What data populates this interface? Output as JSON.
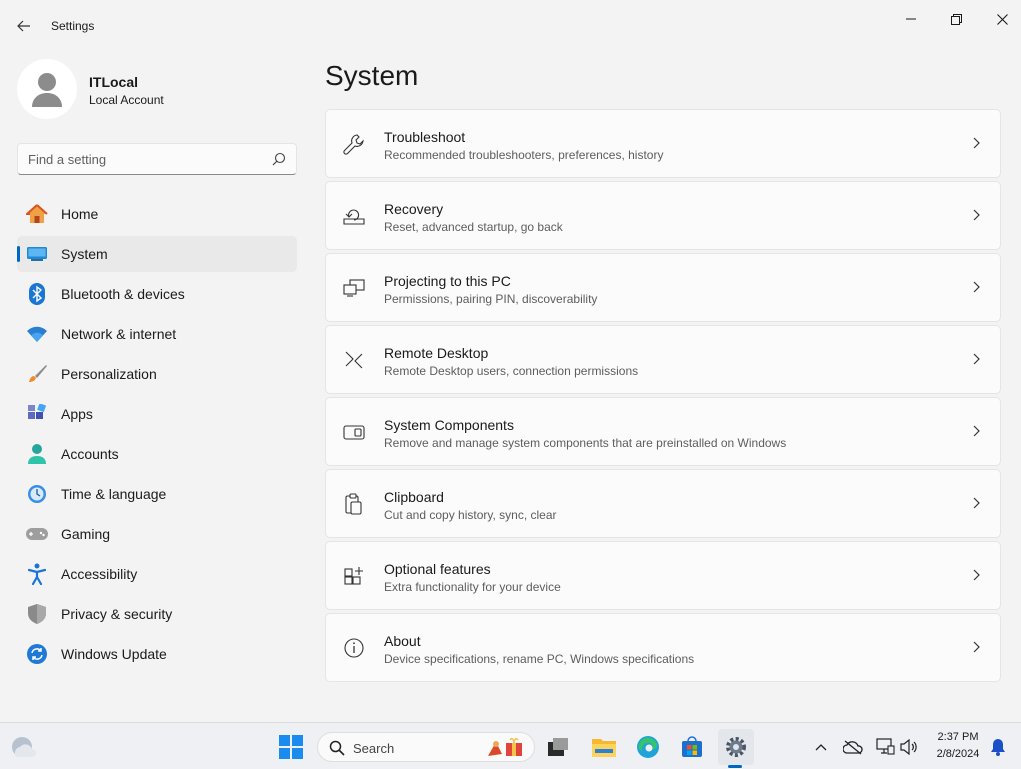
{
  "window": {
    "title": "Settings"
  },
  "profile": {
    "name": "ITLocal",
    "account_type": "Local Account"
  },
  "search": {
    "placeholder": "Find a setting"
  },
  "nav": [
    {
      "label": "Home",
      "icon": "home-icon",
      "active": false
    },
    {
      "label": "System",
      "icon": "system-icon",
      "active": true
    },
    {
      "label": "Bluetooth & devices",
      "icon": "bluetooth-icon",
      "active": false
    },
    {
      "label": "Network & internet",
      "icon": "wifi-icon",
      "active": false
    },
    {
      "label": "Personalization",
      "icon": "brush-icon",
      "active": false
    },
    {
      "label": "Apps",
      "icon": "apps-icon",
      "active": false
    },
    {
      "label": "Accounts",
      "icon": "accounts-icon",
      "active": false
    },
    {
      "label": "Time & language",
      "icon": "time-language-icon",
      "active": false
    },
    {
      "label": "Gaming",
      "icon": "gaming-icon",
      "active": false
    },
    {
      "label": "Accessibility",
      "icon": "accessibility-icon",
      "active": false
    },
    {
      "label": "Privacy & security",
      "icon": "shield-icon",
      "active": false
    },
    {
      "label": "Windows Update",
      "icon": "update-icon",
      "active": false
    }
  ],
  "main": {
    "title": "System",
    "cards": [
      {
        "title": "Troubleshoot",
        "description": "Recommended troubleshooters, preferences, history",
        "icon": "wrench-icon"
      },
      {
        "title": "Recovery",
        "description": "Reset, advanced startup, go back",
        "icon": "recovery-icon"
      },
      {
        "title": "Projecting to this PC",
        "description": "Permissions, pairing PIN, discoverability",
        "icon": "projecting-icon"
      },
      {
        "title": "Remote Desktop",
        "description": "Remote Desktop users, connection permissions",
        "icon": "remote-desktop-icon"
      },
      {
        "title": "System Components",
        "description": "Remove and manage system components that are preinstalled on Windows",
        "icon": "system-components-icon"
      },
      {
        "title": "Clipboard",
        "description": "Cut and copy history, sync, clear",
        "icon": "clipboard-icon"
      },
      {
        "title": "Optional features",
        "description": "Extra functionality for your device",
        "icon": "optional-features-icon"
      },
      {
        "title": "About",
        "description": "Device specifications, rename PC, Windows specifications",
        "icon": "info-icon"
      }
    ]
  },
  "taskbar": {
    "search_placeholder": "Search",
    "time": "2:37 PM",
    "date": "2/8/2024"
  },
  "colors": {
    "accent": "#0067c0",
    "background": "#f3f3f3",
    "card": "#fbfbfb"
  }
}
